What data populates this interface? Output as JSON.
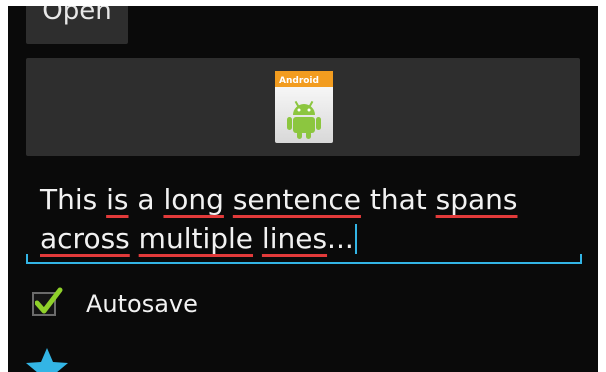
{
  "toolbar": {
    "open_label": "Open"
  },
  "image_button": {
    "icon": "android-app-icon",
    "icon_text": "Android"
  },
  "edit_text": {
    "line1": {
      "w1": "This ",
      "w2": "is",
      "w3": " a ",
      "w4": "long",
      "w5": " ",
      "w6": "sentence",
      "w7": " that ",
      "w8": "spans"
    },
    "line2": {
      "w1": "across",
      "w2": " ",
      "w3": "multiple",
      "w4": " ",
      "w5": "lines",
      "w6": "..."
    },
    "accent_color": "#33b5e5",
    "spellcheck_color": "#e23a3a"
  },
  "autosave": {
    "label": "Autosave",
    "checked": true
  },
  "star": {
    "icon": "star-icon",
    "color": "#33b5e5"
  }
}
